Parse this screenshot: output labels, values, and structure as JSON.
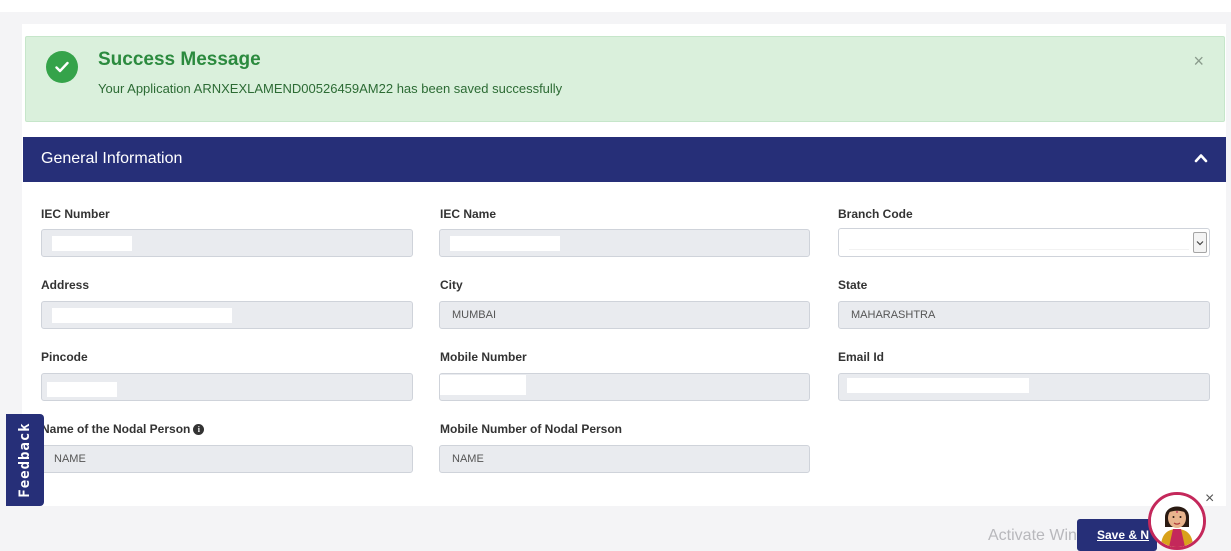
{
  "alert": {
    "title": "Success Message",
    "message": "Your Application ARNXEXLAMEND00526459AM22 has been saved successfully",
    "close": "×"
  },
  "section": {
    "title": "General Information"
  },
  "fields": {
    "iec_number": {
      "label": "IEC Number",
      "value": ""
    },
    "iec_name": {
      "label": "IEC Name",
      "value": ""
    },
    "branch_code": {
      "label": "Branch Code",
      "value": ""
    },
    "address": {
      "label": "Address",
      "value": ""
    },
    "city": {
      "label": "City",
      "value": "MUMBAI"
    },
    "state": {
      "label": "State",
      "value": "MAHARASHTRA"
    },
    "pincode": {
      "label": "Pincode",
      "value": ""
    },
    "mobile_number": {
      "label": "Mobile Number",
      "value": ""
    },
    "email_id": {
      "label": "Email Id",
      "value": ""
    },
    "nodal_person_name": {
      "label": "Name of the Nodal Person",
      "value": "NAME"
    },
    "nodal_person_mobile": {
      "label": "Mobile Number of Nodal Person",
      "value": "NAME"
    }
  },
  "feedback": {
    "label": "Feedback"
  },
  "footer": {
    "save_label": "Save & N",
    "watermark": "Activate Windows",
    "close": "×"
  },
  "colors": {
    "header": "#262f78",
    "success_bg": "#daf0dc",
    "success_icon": "#35a34a"
  },
  "icons": [
    "check-icon",
    "close-icon",
    "chevron-up-icon",
    "chevron-down-icon",
    "info-icon",
    "assistant-avatar-icon"
  ]
}
